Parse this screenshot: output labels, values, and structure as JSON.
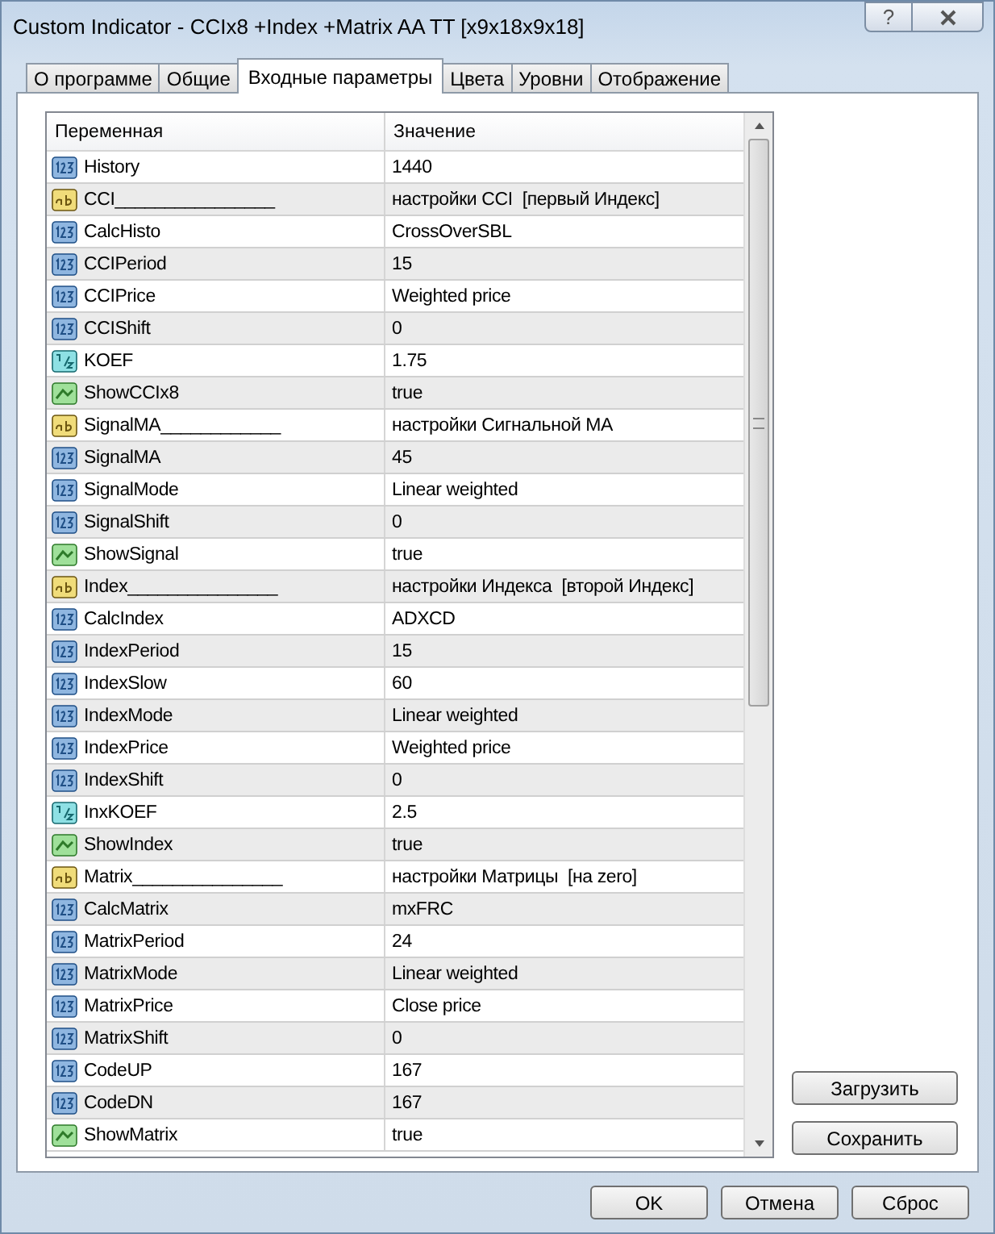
{
  "window": {
    "title": "Custom Indicator - CCIx8 +Index +Matrix AA TT [x9x18x9x18]",
    "help": "?"
  },
  "tabs": [
    {
      "label": "О программе",
      "selected": false
    },
    {
      "label": "Общие",
      "selected": false
    },
    {
      "label": "Входные параметры",
      "selected": true
    },
    {
      "label": "Цвета",
      "selected": false
    },
    {
      "label": "Уровни",
      "selected": false
    },
    {
      "label": "Отображение",
      "selected": false
    }
  ],
  "table": {
    "columns": [
      "Переменная",
      "Значение"
    ],
    "rows": [
      {
        "kind": "int",
        "name": "History",
        "value": "1440"
      },
      {
        "kind": "string",
        "name": "CCI________________",
        "value": "настройки CCI  [первый Индекс]"
      },
      {
        "kind": "int",
        "name": "CalcHisto",
        "value": "CrossOverSBL"
      },
      {
        "kind": "int",
        "name": "CCIPeriod",
        "value": "15"
      },
      {
        "kind": "int",
        "name": "CCIPrice",
        "value": "Weighted price"
      },
      {
        "kind": "int",
        "name": "CCIShift",
        "value": "0"
      },
      {
        "kind": "double",
        "name": "KOEF",
        "value": "1.75"
      },
      {
        "kind": "bool",
        "name": "ShowCCIx8",
        "value": "true"
      },
      {
        "kind": "string",
        "name": "SignalMA____________",
        "value": "настройки Сигнальной MA"
      },
      {
        "kind": "int",
        "name": "SignalMA",
        "value": "45"
      },
      {
        "kind": "int",
        "name": "SignalMode",
        "value": "Linear weighted"
      },
      {
        "kind": "int",
        "name": "SignalShift",
        "value": "0"
      },
      {
        "kind": "bool",
        "name": "ShowSignal",
        "value": "true"
      },
      {
        "kind": "string",
        "name": "Index_______________",
        "value": "настройки Индекса  [второй Индекс]"
      },
      {
        "kind": "int",
        "name": "CalcIndex",
        "value": "ADXCD"
      },
      {
        "kind": "int",
        "name": "IndexPeriod",
        "value": "15"
      },
      {
        "kind": "int",
        "name": "IndexSlow",
        "value": "60"
      },
      {
        "kind": "int",
        "name": "IndexMode",
        "value": "Linear weighted"
      },
      {
        "kind": "int",
        "name": "IndexPrice",
        "value": "Weighted price"
      },
      {
        "kind": "int",
        "name": "IndexShift",
        "value": "0"
      },
      {
        "kind": "double",
        "name": "InxKOEF",
        "value": "2.5"
      },
      {
        "kind": "bool",
        "name": "ShowIndex",
        "value": "true"
      },
      {
        "kind": "string",
        "name": "Matrix_______________",
        "value": "настройки Матрицы  [на zero]"
      },
      {
        "kind": "int",
        "name": "CalcMatrix",
        "value": "mxFRC"
      },
      {
        "kind": "int",
        "name": "MatrixPeriod",
        "value": "24"
      },
      {
        "kind": "int",
        "name": "MatrixMode",
        "value": "Linear weighted"
      },
      {
        "kind": "int",
        "name": "MatrixPrice",
        "value": "Close price"
      },
      {
        "kind": "int",
        "name": "MatrixShift",
        "value": "0"
      },
      {
        "kind": "int",
        "name": "CodeUP",
        "value": "167"
      },
      {
        "kind": "int",
        "name": "CodeDN",
        "value": "167"
      },
      {
        "kind": "bool",
        "name": "ShowMatrix",
        "value": "true"
      }
    ]
  },
  "side_buttons": [
    "Загрузить",
    "Сохранить"
  ],
  "buttons": [
    "OK",
    "Отмена",
    "Сброс"
  ]
}
